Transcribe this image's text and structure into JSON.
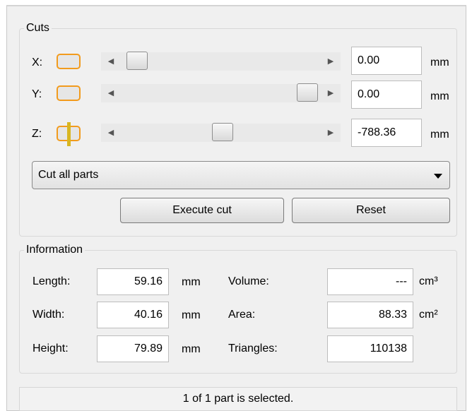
{
  "cuts": {
    "title": "Cuts",
    "rows": [
      {
        "axis": "X:",
        "value": "0.00",
        "unit": "mm",
        "slider_position": 0.02
      },
      {
        "axis": "Y:",
        "value": "0.00",
        "unit": "mm",
        "slider_position": 0.98
      },
      {
        "axis": "Z:",
        "value": "-788.36",
        "unit": "mm",
        "slider_position": 0.5
      }
    ],
    "mode_selected": "Cut all parts",
    "execute_label": "Execute cut",
    "reset_label": "Reset"
  },
  "information": {
    "title": "Information",
    "length_label": "Length:",
    "length_value": "59.16",
    "length_unit": "mm",
    "width_label": "Width:",
    "width_value": "40.16",
    "width_unit": "mm",
    "height_label": "Height:",
    "height_value": "79.89",
    "height_unit": "mm",
    "volume_label": "Volume:",
    "volume_value": "---",
    "volume_unit": "cm³",
    "area_label": "Area:",
    "area_value": "88.33",
    "area_unit": "cm²",
    "triangles_label": "Triangles:",
    "triangles_value": "110138"
  },
  "status": "1 of 1 part is selected.",
  "colors": {
    "axis_icon_border": "#f29b1d",
    "z_plane_bar": "#d8b621"
  }
}
